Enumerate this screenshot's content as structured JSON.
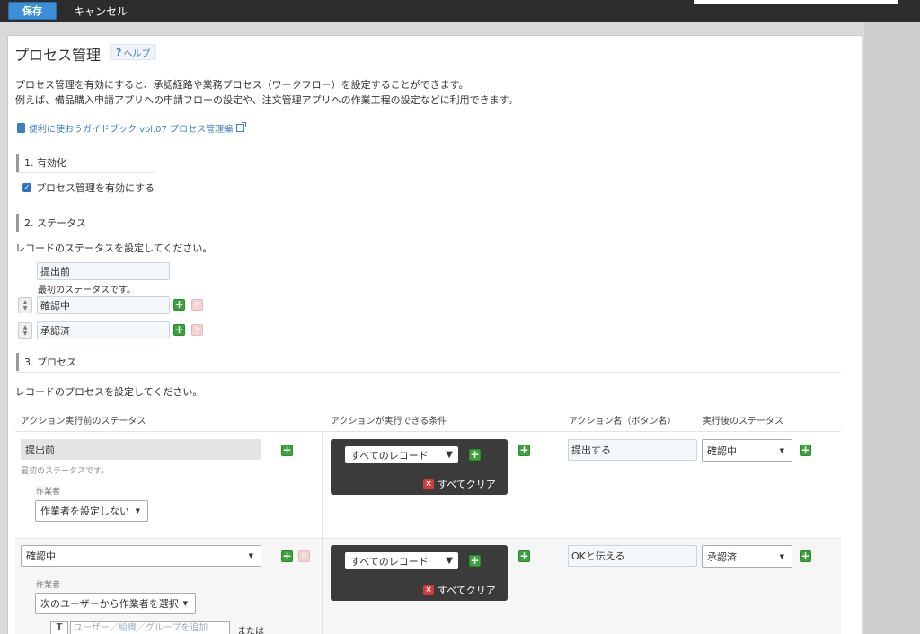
{
  "toolbar": {
    "save_label": "保存",
    "cancel_label": "キャンセル"
  },
  "page": {
    "title": "プロセス管理",
    "help_label": "ヘルプ",
    "help_mark": "?",
    "desc_line1": "プロセス管理を有効にすると、承認経路や業務プロセス（ワークフロー）を設定することができます。",
    "desc_line2": "例えば、備品購入申請アプリへの申請フローの設定や、注文管理アプリへの作業工程の設定などに利用できます。",
    "guide_link": "便利に使おうガイドブック vol.07 プロセス管理編"
  },
  "section1": {
    "heading": "1. 有効化",
    "checkbox_label": "プロセス管理を有効にする",
    "checked_mark": "✓"
  },
  "section2": {
    "heading": "2. ステータス",
    "instruction": "レコードのステータスを設定してください。",
    "first_note": "最初のステータスです。",
    "statuses": [
      "提出前",
      "確認中",
      "承認済"
    ]
  },
  "section3": {
    "heading": "3. プロセス",
    "instruction": "レコードのプロセスを設定してください。",
    "columns": {
      "before_status": "アクション実行前のステータス",
      "condition": "アクションが実行できる条件",
      "action_name": "アクション名（ボタン名）",
      "after_status": "実行後のステータス"
    },
    "rows": [
      {
        "before_status": "提出前",
        "first_note": "最初のステータスです。",
        "assignee_label": "作業者",
        "assignee_value": "作業者を設定しない",
        "condition_value": "すべてのレコード",
        "clear_label": "すべてクリア",
        "action_name": "提出する",
        "after_status": "確認中"
      },
      {
        "before_status": "確認中",
        "assignee_label": "作業者",
        "assignee_value": "次のユーザーから作業者を選択",
        "user_placeholder": "ユーザー／組織／グループを追加",
        "or_label": "または",
        "condition_value": "すべてのレコード",
        "clear_label": "すべてクリア",
        "action_name": "OKと伝える",
        "after_status": "承認済"
      }
    ]
  },
  "icons": {
    "plus": "+",
    "remove": "×",
    "caret_small": "▼",
    "caret_cond": "▼",
    "sort_up": "▲",
    "sort_down": "▼",
    "user_icon": "T"
  }
}
